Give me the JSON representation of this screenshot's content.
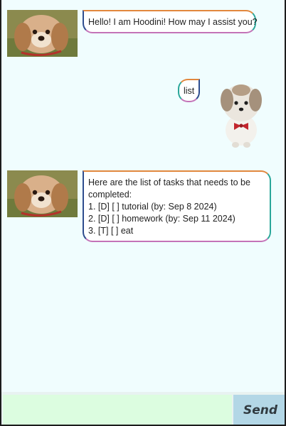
{
  "messages": [
    {
      "sender": "bot",
      "avatar_icon": "dog-photo-icon",
      "lines": [
        "Hello! I am Hoodini! How may I assist you?"
      ]
    },
    {
      "sender": "user",
      "avatar_icon": "white-dog-with-bow-icon",
      "lines": [
        "list"
      ]
    },
    {
      "sender": "bot",
      "avatar_icon": "dog-photo-icon",
      "lines": [
        "Here are the list of tasks that needs to be",
        "completed:",
        "1. [D] [ ] tutorial (by: Sep 8 2024)",
        "2. [D] [ ] homework (by: Sep 11 2024)",
        "3. [T] [ ] eat"
      ]
    }
  ],
  "input": {
    "value": "",
    "placeholder": ""
  },
  "send_button": {
    "label": "Send"
  },
  "colors": {
    "chat_background": "#f0fdfe",
    "input_background": "#dcfde0",
    "send_button_background": "#b3d7e6",
    "bubble_border_orange": "#e2873d",
    "bubble_border_teal": "#2aa79a",
    "bubble_border_pink": "#c373b8"
  }
}
